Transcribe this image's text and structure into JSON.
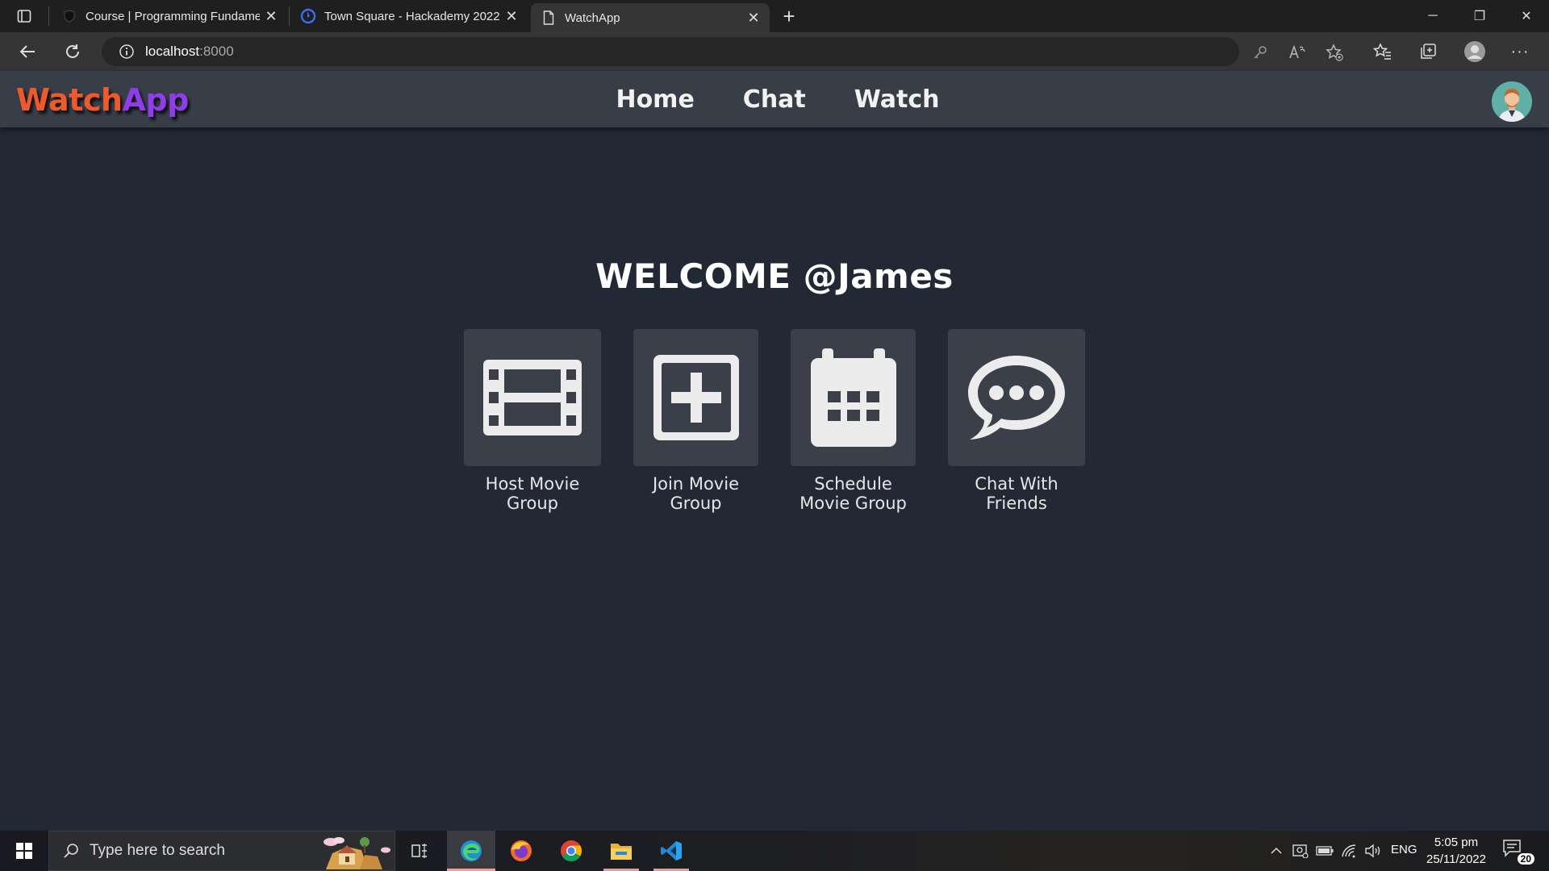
{
  "browser": {
    "tabs": [
      {
        "title": "Course | Programming Fundame",
        "close": "✕"
      },
      {
        "title": "Town Square - Hackademy 2022",
        "close": "✕"
      },
      {
        "title": "WatchApp",
        "close": "✕"
      }
    ],
    "new_tab": "+",
    "window_controls": {
      "minimize": "─",
      "restore": "❐",
      "close": "✕"
    },
    "address": {
      "host": "localhost",
      "port": ":8000"
    },
    "more_menu": "···"
  },
  "app": {
    "logo": {
      "part1": "Watch",
      "part2": "App"
    },
    "nav": {
      "home": "Home",
      "chat": "Chat",
      "watch": "Watch"
    },
    "welcome": "WELCOME @James",
    "cards": [
      {
        "icon": "film-icon",
        "line1": "Host Movie",
        "line2": "Group"
      },
      {
        "icon": "plus-square-icon",
        "line1": "Join Movie",
        "line2": "Group"
      },
      {
        "icon": "calendar-icon",
        "line1": "Schedule",
        "line2": "Movie Group"
      },
      {
        "icon": "chat-bubble-icon",
        "line1": "Chat With",
        "line2": "Friends"
      }
    ],
    "colors": {
      "background": "#222834",
      "navbar": "#383e48",
      "tile": "#3a3f4a",
      "logo_watch": "#ee5a2c",
      "logo_app": "#8f3ce9"
    }
  },
  "taskbar": {
    "search_placeholder": "Type here to search",
    "tray": {
      "language": "ENG",
      "time": "5:05 pm",
      "date": "25/11/2022",
      "notification_count": "20"
    }
  }
}
